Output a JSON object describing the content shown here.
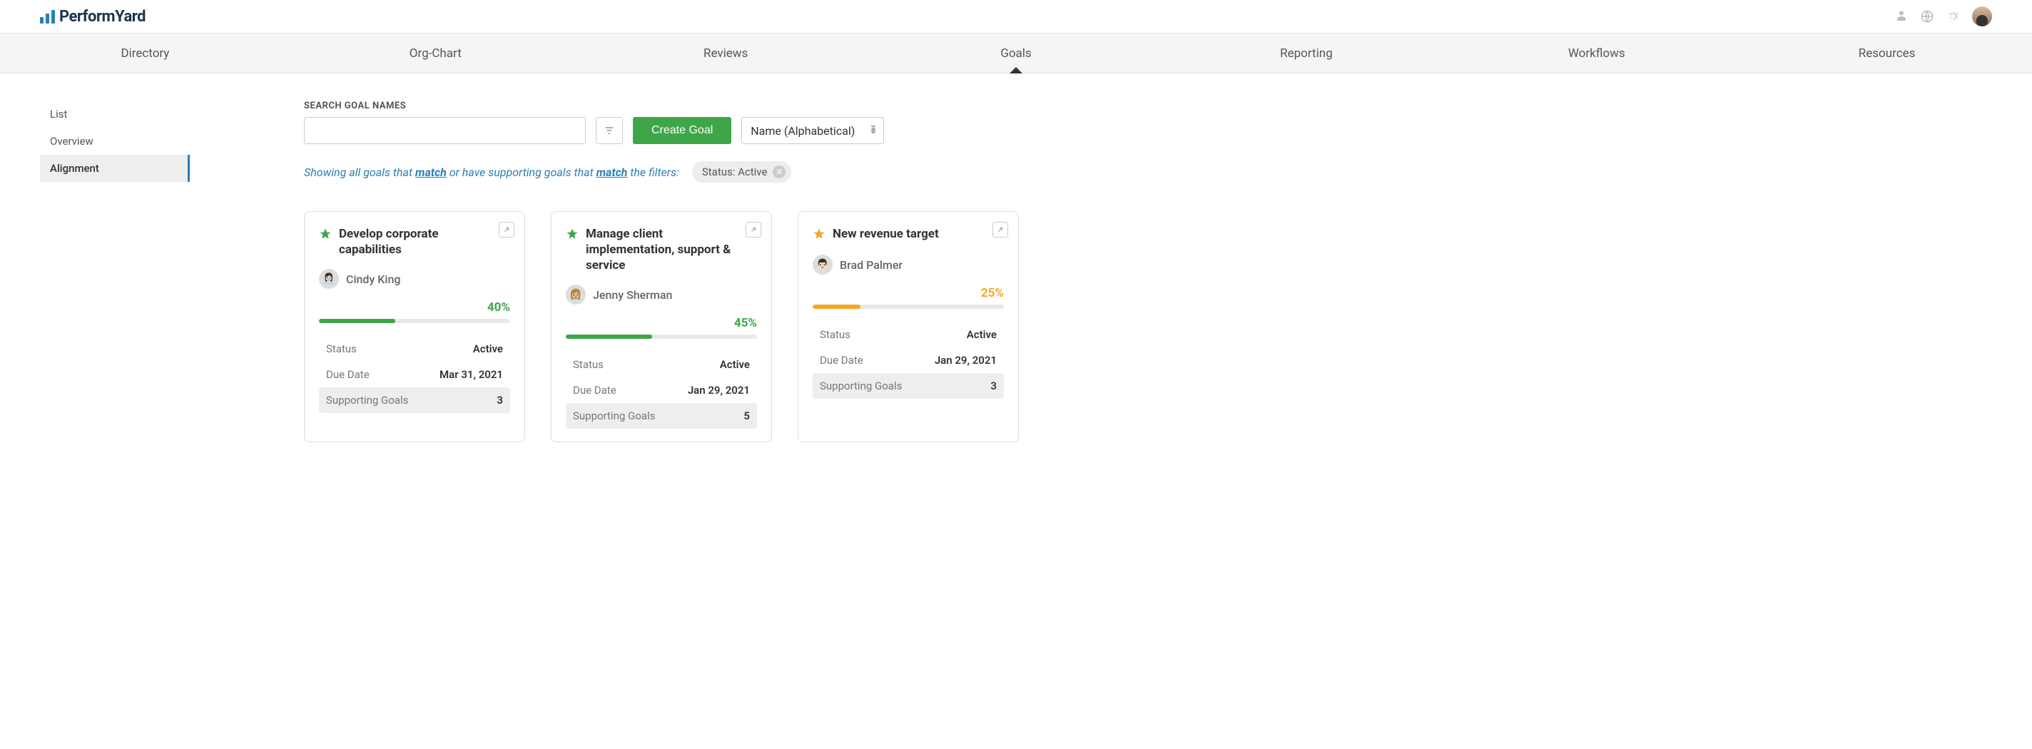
{
  "brand": "PerformYard",
  "nav": {
    "items": [
      "Directory",
      "Org-Chart",
      "Reviews",
      "Goals",
      "Reporting",
      "Workflows",
      "Resources"
    ],
    "activeIndex": 3
  },
  "sidebar": {
    "items": [
      "List",
      "Overview",
      "Alignment"
    ],
    "activeIndex": 2
  },
  "search": {
    "label": "SEARCH GOAL NAMES",
    "value": ""
  },
  "createButton": "Create Goal",
  "sort": {
    "selected": "Name (Alphabetical)"
  },
  "filterDesc": {
    "part1": "Showing all goals that ",
    "match1": "match",
    "part2": " or have supporting goals that ",
    "match2": "match",
    "part3": " the filters:"
  },
  "filterChip": {
    "label": "Status: Active"
  },
  "metaLabels": {
    "status": "Status",
    "dueDate": "Due Date",
    "supporting": "Supporting Goals"
  },
  "cards": [
    {
      "title": "Develop corporate capabilities",
      "owner": "Cindy King",
      "ownerAvatar": "👩🏻‍💼",
      "progress": 40,
      "progressText": "40%",
      "color": "green",
      "status": "Active",
      "dueDate": "Mar 31, 2021",
      "supportingGoals": "3"
    },
    {
      "title": "Manage client implementation, support & service",
      "owner": "Jenny Sherman",
      "ownerAvatar": "👩🏼",
      "progress": 45,
      "progressText": "45%",
      "color": "green",
      "status": "Active",
      "dueDate": "Jan 29, 2021",
      "supportingGoals": "5"
    },
    {
      "title": "New revenue target",
      "owner": "Brad Palmer",
      "ownerAvatar": "👨🏻",
      "progress": 25,
      "progressText": "25%",
      "color": "yellow",
      "status": "Active",
      "dueDate": "Jan 29, 2021",
      "supportingGoals": "3"
    }
  ]
}
